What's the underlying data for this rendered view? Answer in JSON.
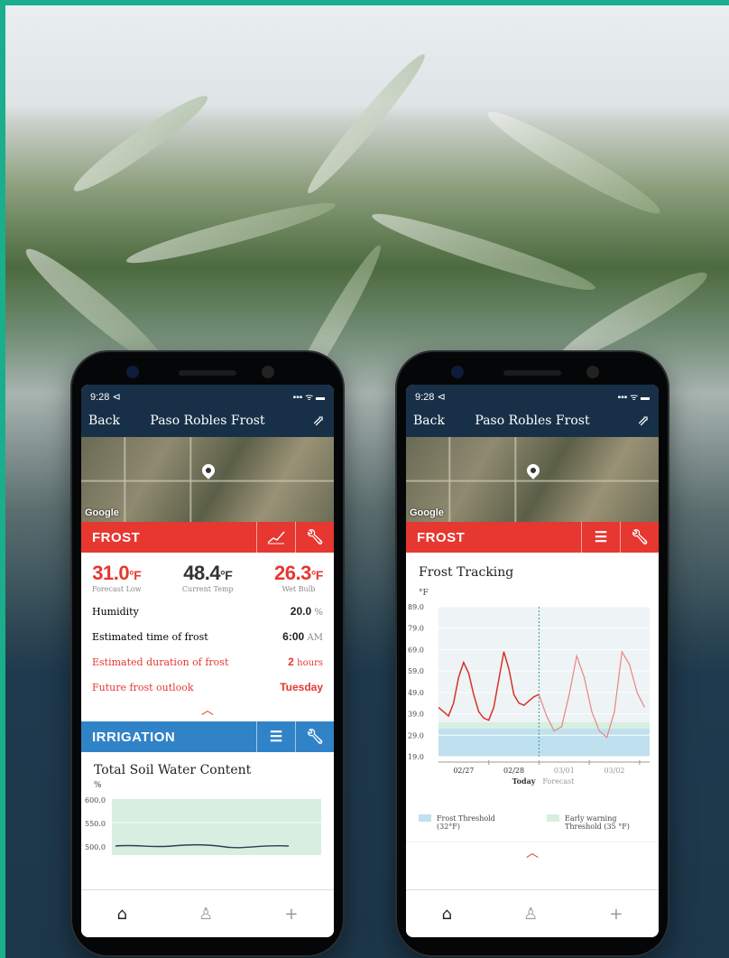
{
  "phones": [
    {
      "status": {
        "time": "9:28 ⊲",
        "signals": "▪▪▪ ᯤ ▬"
      },
      "nav": {
        "back": "Back",
        "title": "Paso Robles Frost",
        "share_icon": "share-icon"
      },
      "map": {
        "attribution": "Google"
      },
      "frost_card": {
        "header": "FROST",
        "temps": [
          {
            "value": "31.0",
            "unit": "°F",
            "label": "Forecast Low",
            "color": "#e63730"
          },
          {
            "value": "48.4",
            "unit": "°F",
            "label": "Current Temp",
            "color": "#333333"
          },
          {
            "value": "26.3",
            "unit": "°F",
            "label": "Wet Bulb",
            "color": "#e63730"
          }
        ],
        "rows": [
          {
            "label": "Humidity",
            "value": "20.0",
            "unit": "%",
            "alert": false
          },
          {
            "label": "Estimated time of frost",
            "value": "6:00",
            "unit": "AM",
            "alert": false
          },
          {
            "label": "Estimated duration of frost",
            "value": "2",
            "unit": "hours",
            "alert": true
          },
          {
            "label": "Future frost outlook",
            "value": "Tuesday",
            "unit": "",
            "alert": true
          }
        ]
      },
      "irrigation_card": {
        "header": "IRRIGATION",
        "title": "Total Soil Water Content",
        "unit": "%",
        "ticks": [
          "600.0",
          "550.0",
          "500.0"
        ]
      }
    },
    {
      "status": {
        "time": "9:28 ⊲",
        "signals": "▪▪▪ ᯤ ▬"
      },
      "nav": {
        "back": "Back",
        "title": "Paso Robles Frost",
        "share_icon": "share-icon"
      },
      "map": {
        "attribution": "Google"
      },
      "frost_card": {
        "header": "FROST",
        "title": "Frost Tracking",
        "unit": "°F",
        "legend": [
          {
            "label": "Frost Threshold (32°F)",
            "color": "#bfe0ee"
          },
          {
            "label": "Early warning Threshold (35 °F)",
            "color": "#d6efe0"
          }
        ]
      }
    }
  ],
  "chart_data": {
    "type": "line",
    "title": "Frost Tracking",
    "ylabel": "°F",
    "ylim": [
      19.0,
      89.0
    ],
    "y_ticks": [
      "89.0",
      "79.0",
      "69.0",
      "59.0",
      "49.0",
      "39.0",
      "29.0",
      "19.0"
    ],
    "x_ticks": [
      "02/27",
      "02/28",
      "03/01",
      "03/02"
    ],
    "today_label": "Today",
    "forecast_label": "Forecast",
    "thresholds": [
      {
        "name": "Frost Threshold (32°F)",
        "value": 32
      },
      {
        "name": "Early warning Threshold (35 °F)",
        "value": 35
      }
    ],
    "series": [
      {
        "name": "",
        "color": "#d8302a",
        "x": [
          0,
          0.1,
          0.2,
          0.3,
          0.4,
          0.5,
          0.6,
          0.7,
          0.8,
          0.9,
          1.0,
          1.1,
          1.2,
          1.3,
          1.4,
          1.5,
          1.6,
          1.7,
          1.8,
          1.9,
          2.0
        ],
        "y": [
          42,
          40,
          38,
          44,
          56,
          63,
          58,
          48,
          40,
          37,
          36,
          42,
          55,
          68,
          60,
          48,
          44,
          43,
          45,
          47,
          48
        ]
      },
      {
        "name": "",
        "color": "#e88682",
        "x": [
          2.0,
          2.15,
          2.3,
          2.45,
          2.6,
          2.75,
          2.9,
          3.05,
          3.2,
          3.35,
          3.5,
          3.65,
          3.8,
          3.95,
          4.1
        ],
        "y": [
          48,
          38,
          31,
          33,
          48,
          66,
          56,
          40,
          31,
          28,
          40,
          68,
          62,
          49,
          42
        ]
      }
    ]
  }
}
